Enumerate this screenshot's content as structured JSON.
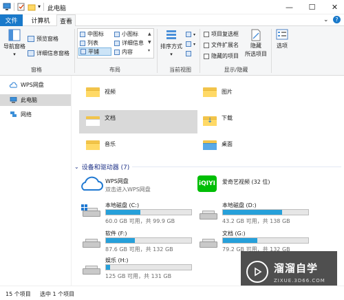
{
  "window": {
    "title": "此电脑"
  },
  "tabs": {
    "file": "文件",
    "computer": "计算机",
    "view": "查看"
  },
  "ribbon": {
    "pane_group": {
      "nav_pane": "导航窗格",
      "preview_pane": "预览窗格",
      "details_pane": "详细信息窗格",
      "label": "窗格"
    },
    "layout_group": {
      "medium_icons": "中图标",
      "small_icons": "小图标",
      "list": "列表",
      "details": "详细信息",
      "tiles": "平铺",
      "content": "内容",
      "label": "布局"
    },
    "current_view_group": {
      "sort": "排序方式",
      "label": "当前视图"
    },
    "show_hide_group": {
      "item_checkboxes": "项目复选框",
      "file_extensions": "文件扩展名",
      "hidden_items": "隐藏的项目",
      "hide_selected_1": "隐藏",
      "hide_selected_2": "所选项目",
      "label": "显示/隐藏"
    },
    "options": "选项"
  },
  "nav": {
    "items": [
      {
        "label": "WPS网盘"
      },
      {
        "label": "此电脑",
        "selected": true
      },
      {
        "label": "网络"
      }
    ]
  },
  "folders": [
    {
      "label": "视频"
    },
    {
      "label": "图片"
    },
    {
      "label": "文档",
      "selected": true
    },
    {
      "label": "下载"
    },
    {
      "label": "音乐"
    },
    {
      "label": "桌面"
    }
  ],
  "devices_header": "设备和驱动器 (7)",
  "apps": {
    "wps": {
      "name": "WPS网盘",
      "sub": "双击进入WPS网盘"
    },
    "iqiyi": {
      "name": "爱奇艺视频 (32 位)",
      "logo": "iQIYI"
    }
  },
  "drives": [
    {
      "name": "本地磁盘 (C:)",
      "free": "60.0 GB 可用，共 99.9 GB",
      "used_fraction": 0.4
    },
    {
      "name": "本地磁盘 (D:)",
      "free": "43.2 GB 可用，共 138 GB",
      "used_fraction": 0.69
    },
    {
      "name": "软件 (F:)",
      "free": "87.6 GB 可用，共 132 GB",
      "used_fraction": 0.34
    },
    {
      "name": "文档 (G:)",
      "free": "79.2 GB 可用，共 132 GB",
      "used_fraction": 0.4
    },
    {
      "name": "娱乐 (H:)",
      "free": "125 GB 可用，共 131 GB",
      "used_fraction": 0.05
    }
  ],
  "status": {
    "count": "15 个项目",
    "selected": "选中 1 个项目"
  },
  "watermark": {
    "title": "溜溜自学",
    "url": "ZIXUE.3D66.COM"
  },
  "colors": {
    "accent": "#1979ca",
    "bar_fill": "#26a0da",
    "selection": "#d9d9d9",
    "folder": "#ffd966"
  }
}
